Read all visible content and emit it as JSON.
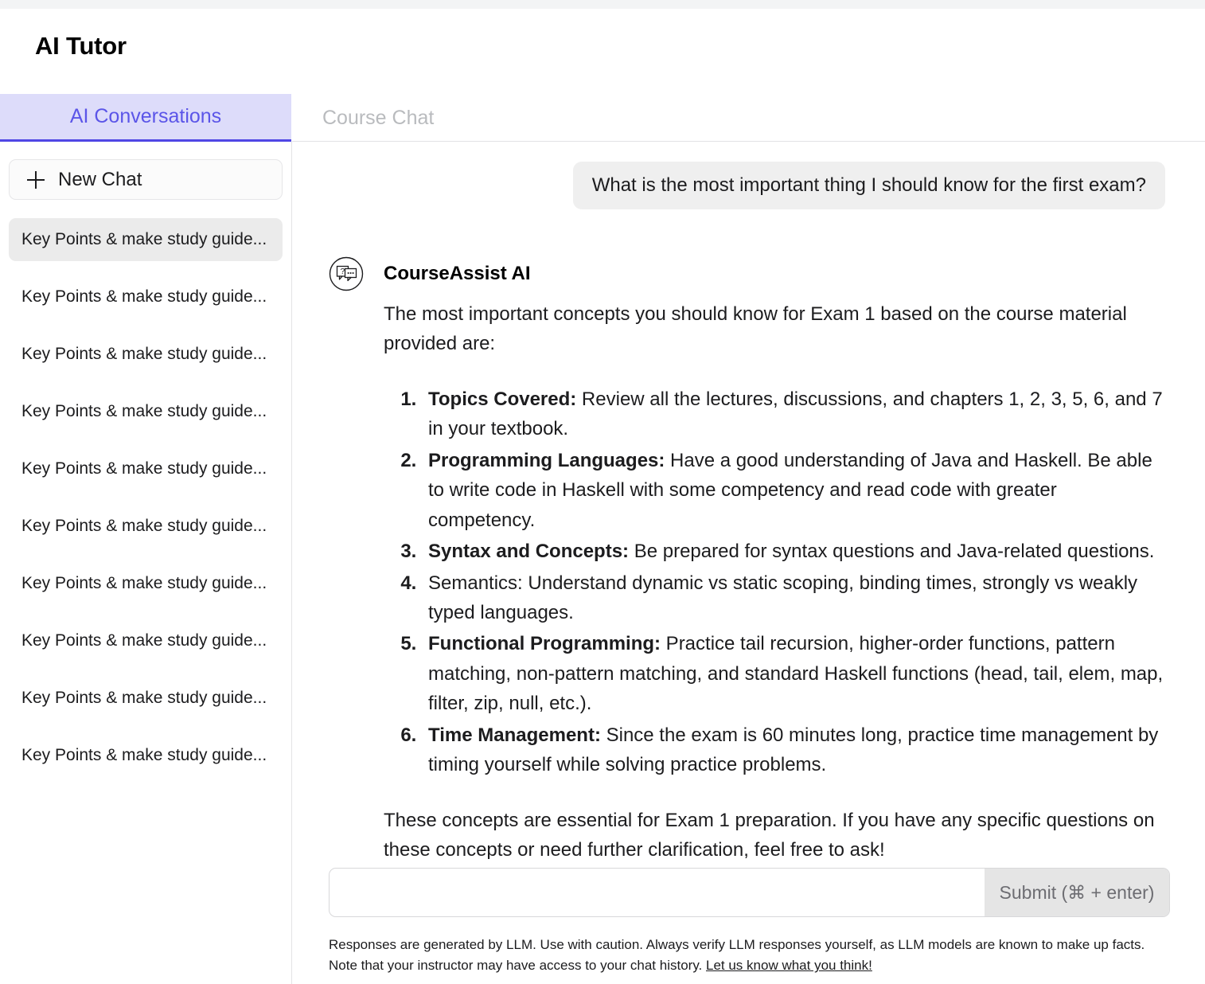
{
  "app": {
    "title": "AI Tutor"
  },
  "tabs": [
    {
      "label": "AI Conversations",
      "active": true
    },
    {
      "label": "Course Chat",
      "active": false
    }
  ],
  "sidebar": {
    "new_chat_label": "New Chat",
    "new_chat_icon": "plus-icon",
    "conversations": [
      {
        "label": "Key Points & make study guide...",
        "selected": true
      },
      {
        "label": "Key Points & make study guide...",
        "selected": false
      },
      {
        "label": "Key Points & make study guide...",
        "selected": false
      },
      {
        "label": "Key Points & make study guide...",
        "selected": false
      },
      {
        "label": "Key Points & make study guide...",
        "selected": false
      },
      {
        "label": "Key Points & make study guide...",
        "selected": false
      },
      {
        "label": "Key Points & make study guide...",
        "selected": false
      },
      {
        "label": "Key Points & make study guide...",
        "selected": false
      },
      {
        "label": "Key Points & make study guide...",
        "selected": false
      },
      {
        "label": "Key Points & make study guide...",
        "selected": false
      }
    ]
  },
  "conversation": {
    "user_message": "What is the most important thing I should know for the first exam?",
    "assistant_name": "CourseAssist AI",
    "assistant_avatar_icon": "chat-question-icon",
    "assistant_intro": "The most important concepts you should know for Exam 1 based on the course material provided are:",
    "assistant_items": [
      {
        "lead": "Topics Covered:",
        "lead_bold": true,
        "text": " Review all the lectures, discussions, and chapters 1, 2, 3, 5, 6, and 7 in your textbook."
      },
      {
        "lead": "Programming Languages:",
        "lead_bold": true,
        "text": " Have a good understanding of Java and Haskell. Be able to write code in Haskell with some competency and read code with greater competency."
      },
      {
        "lead": "Syntax and Concepts:",
        "lead_bold": true,
        "text": " Be prepared for syntax questions and Java-related questions."
      },
      {
        "lead": "Semantics:",
        "lead_bold": false,
        "text": " Understand dynamic vs static scoping, binding times, strongly vs weakly typed languages."
      },
      {
        "lead": "Functional Programming:",
        "lead_bold": true,
        "text": " Practice tail recursion, higher-order functions, pattern matching, non-pattern matching, and standard Haskell functions (head, tail, elem, map, filter, zip, null, etc.)."
      },
      {
        "lead": "Time Management:",
        "lead_bold": true,
        "text": " Since the exam is 60 minutes long, practice time management by timing yourself while solving practice problems."
      }
    ],
    "assistant_closing": "These concepts are essential for Exam 1 preparation. If you have any specific questions on these concepts or need further clarification, feel free to ask!"
  },
  "composer": {
    "input_value": "",
    "input_placeholder": "",
    "submit_label": "Submit (⌘ + enter)"
  },
  "footer": {
    "disclaimer_text": "Responses are generated by LLM. Use with caution. Always verify LLM responses yourself, as LLM models are known to make up facts. Note that your instructor may have access to your chat history. ",
    "feedback_link": "Let us know what you think!"
  },
  "colors": {
    "accent": "#4f46e5",
    "accent_tab_bg": "#dddcfa",
    "selected_item_bg": "#ebebeb",
    "user_bubble_bg": "#efefef",
    "submit_bg": "#e5e5e5",
    "inactive_tab_text": "#b9bbbe"
  }
}
